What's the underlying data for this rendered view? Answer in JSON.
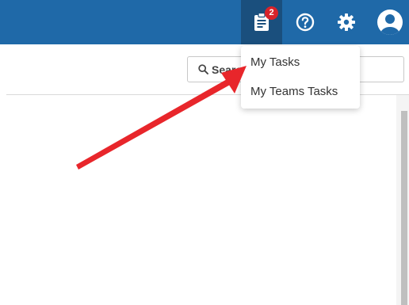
{
  "topbar": {
    "background_color": "#1f69a8",
    "active_color": "#1a4f7d",
    "tasks_button": {
      "icon": "clipboard-icon",
      "badge_count": "2",
      "badge_color": "#d8232a"
    },
    "help_button": {
      "icon": "question-circle-icon"
    },
    "settings_button": {
      "icon": "gear-icon"
    },
    "account_button": {
      "icon": "user-circle-icon"
    }
  },
  "search": {
    "placeholder": "Search",
    "icon": "search-icon"
  },
  "tasks_menu": {
    "items": [
      {
        "label": "My Tasks"
      },
      {
        "label": "My Teams Tasks"
      }
    ]
  },
  "annotation": {
    "arrow_color": "#e8262b"
  }
}
